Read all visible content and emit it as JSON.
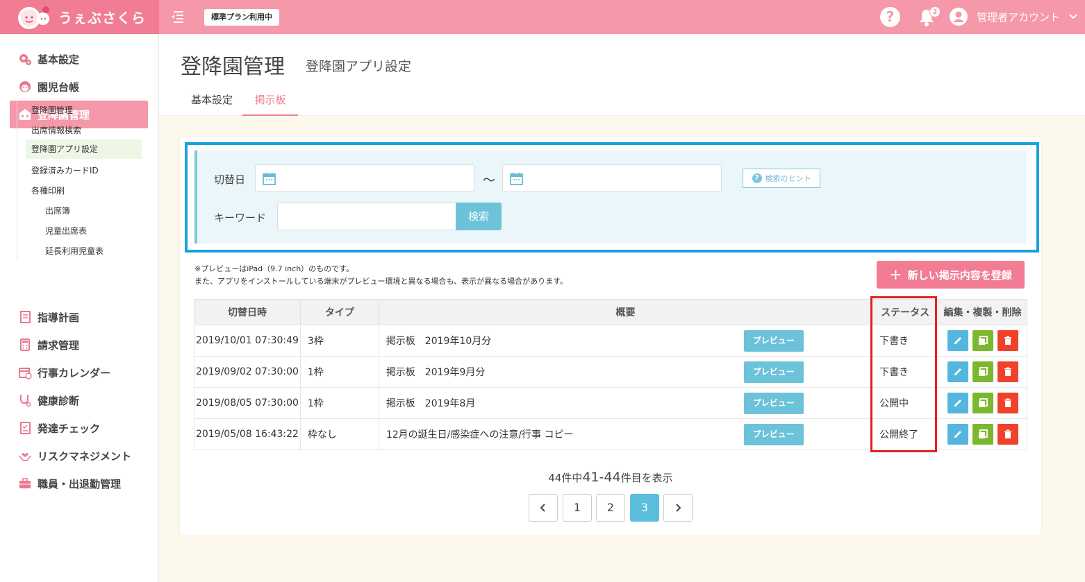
{
  "header": {
    "app_name": "うぇぶさくら",
    "plan_badge": "標準プラン利用中",
    "help_label": "?",
    "notification_count": "2",
    "user_name": "管理者アカウント",
    "accent_color": "#f598a9"
  },
  "sidebar": {
    "items": [
      {
        "label": "基本設定",
        "icon": "gear-icon"
      },
      {
        "label": "園児台帳",
        "icon": "child-face-icon"
      },
      {
        "label": "登降園管理",
        "icon": "school-icon"
      },
      {
        "label": "指導計画",
        "icon": "notebook-icon"
      },
      {
        "label": "請求管理",
        "icon": "calculator-icon"
      },
      {
        "label": "行事カレンダー",
        "icon": "calendar-icon"
      },
      {
        "label": "健康診断",
        "icon": "stethoscope-icon"
      },
      {
        "label": "発達チェック",
        "icon": "checklist-icon"
      },
      {
        "label": "リスクマネジメント",
        "icon": "hands-heart-icon"
      },
      {
        "label": "職員・出退勤管理",
        "icon": "briefcase-icon"
      }
    ],
    "sub_items": [
      {
        "label": "登降園管理"
      },
      {
        "label": "出席情報検索"
      },
      {
        "label": "登降園アプリ設定"
      },
      {
        "label": "登録済みカードID"
      },
      {
        "label": "各種印刷"
      },
      {
        "label": "出席簿"
      },
      {
        "label": "児童出席表"
      },
      {
        "label": "延長利用児童表"
      }
    ]
  },
  "page": {
    "title": "登降園管理",
    "subtitle": "登降園アプリ設定",
    "tabs": [
      "基本設定",
      "掲示板"
    ]
  },
  "search": {
    "date_label": "切替日",
    "tilde": "～",
    "hint_label": "検索のヒント",
    "keyword_label": "キーワード",
    "search_button": "検索"
  },
  "notes": {
    "line1": "※プレビューはiPad（9.7 inch）のものです。",
    "line2": "また、アプリをインストールしている端末がプレビュー環境と異なる場合も、表示が異なる場合があります。"
  },
  "new_button": "新しい掲示内容を登録",
  "table": {
    "headers": [
      "切替日時",
      "タイプ",
      "概要",
      "ステータス",
      "編集・複製・削除"
    ],
    "preview_label": "プレビュー",
    "rows": [
      {
        "date": "2019/10/01 07:30:49",
        "type": "3枠",
        "summary": "掲示板　2019年10月分",
        "status": "下書き"
      },
      {
        "date": "2019/09/02 07:30:00",
        "type": "1枠",
        "summary": "掲示板　2019年9月分",
        "status": "下書き"
      },
      {
        "date": "2019/08/05 07:30:00",
        "type": "1枠",
        "summary": "掲示板　2019年8月",
        "status": "公開中"
      },
      {
        "date": "2019/05/08 16:43:22",
        "type": "枠なし",
        "summary": "12月の誕生日/感染症への注意/行事 コピー",
        "status": "公開終了"
      }
    ]
  },
  "pagination": {
    "info_prefix": "44件中",
    "info_range": "41-44",
    "info_suffix": "件目を表示",
    "pages": [
      "1",
      "2",
      "3"
    ],
    "current": "3"
  }
}
